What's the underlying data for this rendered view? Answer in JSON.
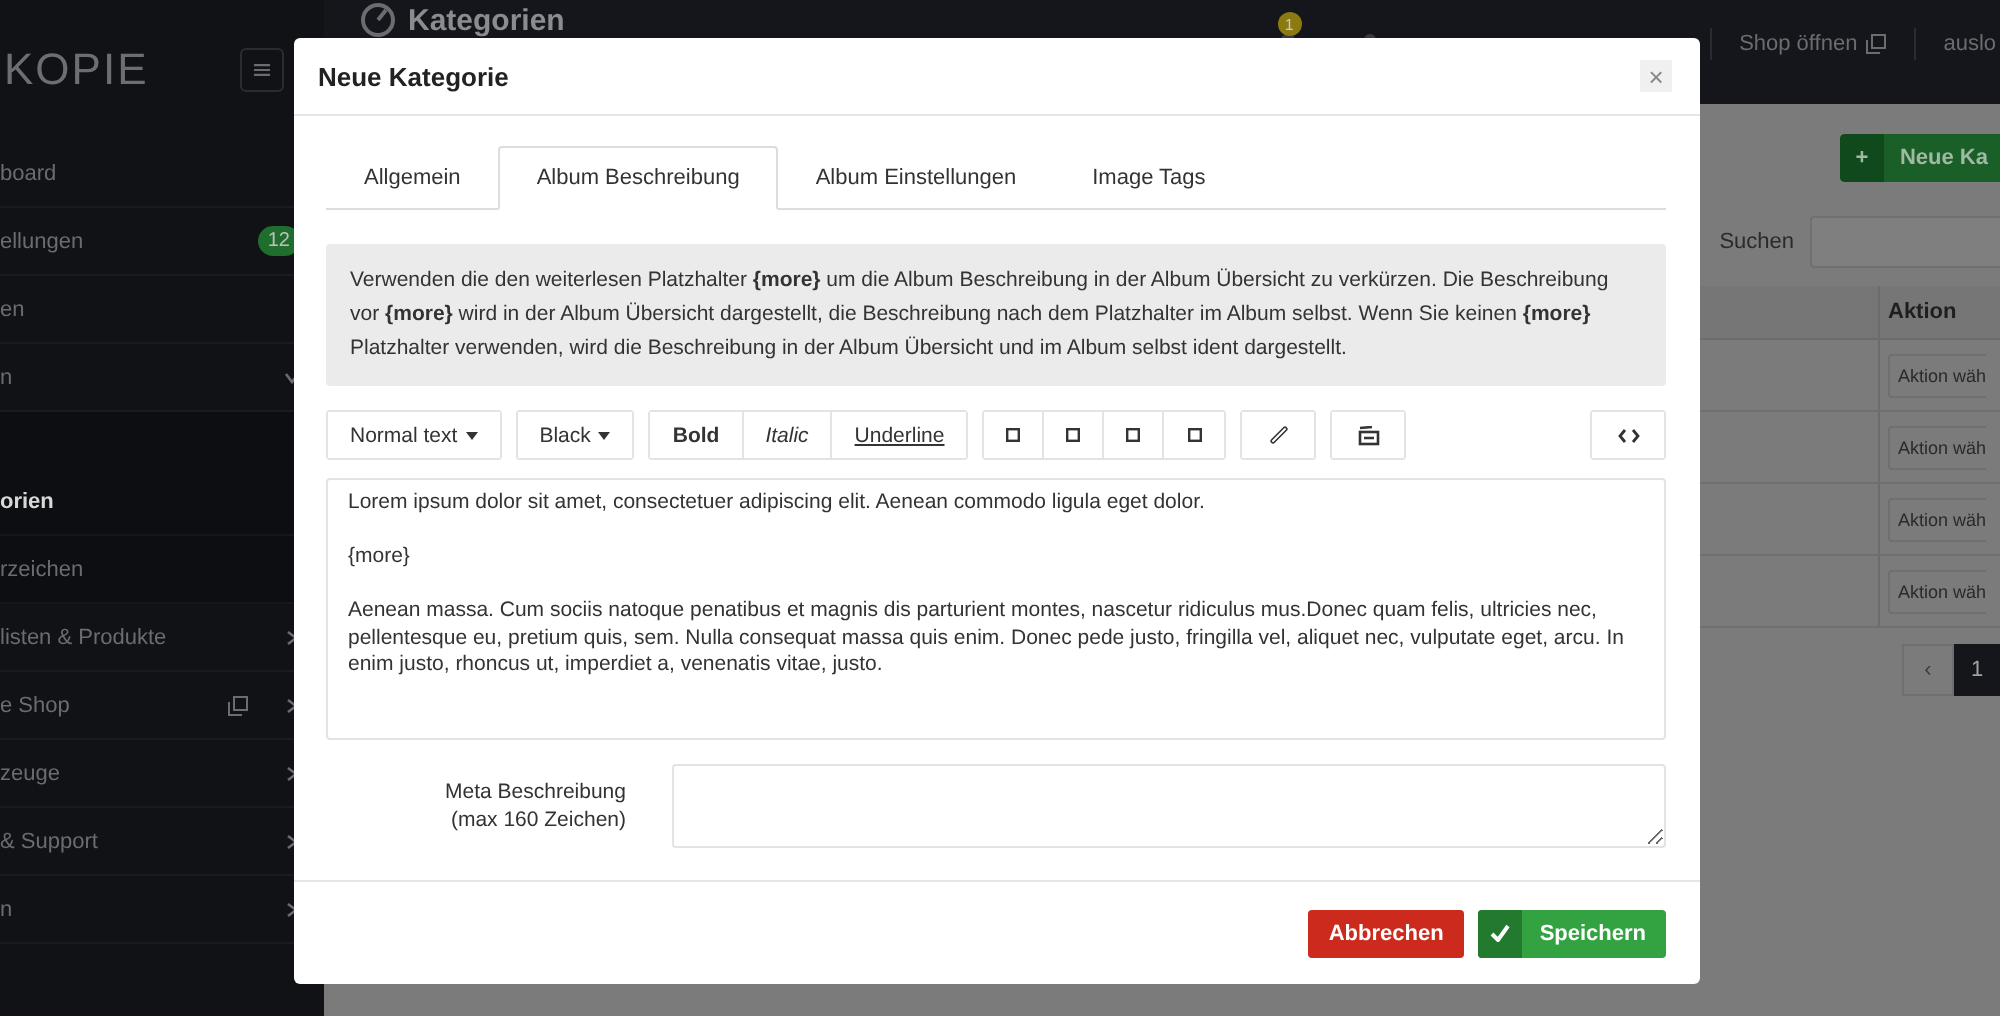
{
  "sidebar": {
    "logo": "KOPIE",
    "items": [
      {
        "label": "board",
        "kind": "plain",
        "selected": false
      },
      {
        "label": "ellungen",
        "kind": "plain",
        "selected": false,
        "badge": "12"
      },
      {
        "label": "en",
        "kind": "plain",
        "selected": false
      },
      {
        "label": "n",
        "kind": "parent",
        "selected": false,
        "expanded": true,
        "children": [
          {
            "label": "orien",
            "selected": true
          },
          {
            "label": "rzeichen",
            "selected": false
          }
        ]
      },
      {
        "label": "listen & Produkte",
        "kind": "parent",
        "selected": false,
        "expanded": false
      },
      {
        "label": "e Shop",
        "kind": "external",
        "selected": false,
        "expanded": false
      },
      {
        "label": "zeuge",
        "kind": "parent",
        "selected": false,
        "expanded": false
      },
      {
        "label": "& Support",
        "kind": "parent",
        "selected": false,
        "expanded": false
      },
      {
        "label": "n",
        "kind": "parent",
        "selected": false,
        "expanded": false
      }
    ]
  },
  "topbar": {
    "title": "Kategorien",
    "notification_count": "1",
    "shop_link": "Shop öffnen",
    "logout": "auslo"
  },
  "content": {
    "new_button": "+",
    "new_label": "Neue Ka",
    "search_label": "Suchen",
    "table": {
      "columns": [
        "Aktion"
      ],
      "rows": [
        "Aktion wäh",
        "Aktion wäh",
        "Aktion wäh",
        "Aktion wäh"
      ]
    },
    "pagination": [
      {
        "label": "‹",
        "selected": false
      },
      {
        "label": "1",
        "selected": true
      }
    ]
  },
  "modal": {
    "title": "Neue Kategorie",
    "close": "×",
    "tabs": [
      {
        "label": "Allgemein",
        "selected": false
      },
      {
        "label": "Album Beschreibung",
        "selected": true
      },
      {
        "label": "Album Einstellungen",
        "selected": false
      },
      {
        "label": "Image Tags",
        "selected": false
      }
    ],
    "info": "Verwenden die den weiterlesen Platzhalter **{more}** um die Album Beschreibung in der Album Übersicht zu verkürzen. Die Beschreibung vor **{more}** wird in der Album Übersicht dargestellt, die Beschreibung nach dem Platzhalter im Album selbst. Wenn Sie keinen **{more}** Platzhalter verwenden, wird die Beschreibung in der Album Übersicht und im Album selbst ident dargestellt.",
    "toolbar": [
      [
        {
          "kind": "dropdown",
          "label": "Normal text"
        }
      ],
      [
        {
          "kind": "dropdown",
          "label": "Black"
        }
      ],
      [
        {
          "kind": "bold",
          "label": "Bold"
        },
        {
          "kind": "italic",
          "label": "Italic"
        },
        {
          "kind": "underline",
          "label": "Underline"
        }
      ],
      [
        {
          "kind": "square"
        },
        {
          "kind": "square"
        },
        {
          "kind": "square"
        },
        {
          "kind": "square"
        }
      ],
      [
        {
          "kind": "link"
        }
      ],
      [
        {
          "kind": "media"
        }
      ],
      [
        {
          "kind": "code"
        }
      ]
    ],
    "editor": [
      "Lorem ipsum dolor sit amet, consectetuer adipiscing elit. Aenean commodo ligula eget dolor.",
      "{more}",
      "Aenean massa. Cum sociis natoque penatibus et magnis dis parturient montes, nascetur ridiculus mus.Donec quam felis, ultricies nec, pellentesque eu, pretium quis, sem. Nulla consequat massa quis enim. Donec pede justo, fringilla vel, aliquet nec, vulputate eget, arcu. In enim justo, rhoncus ut, imperdiet a, venenatis vitae, justo."
    ],
    "meta_label": "Meta Beschreibung",
    "meta_hint": "(max 160 Zeichen)",
    "buttons": [
      {
        "kind": "cancel",
        "label": "Abbrechen"
      },
      {
        "kind": "save",
        "label": "Speichern"
      }
    ]
  }
}
